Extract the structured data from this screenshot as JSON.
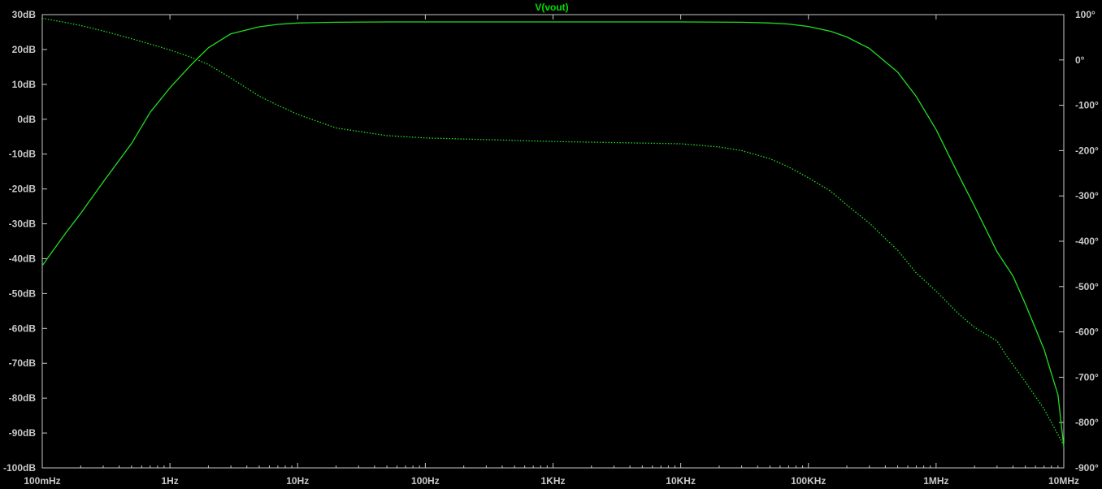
{
  "colors": {
    "background": "#000000",
    "axis": "#c8c8c8",
    "trace": "#22dd22"
  },
  "chart_data": {
    "type": "line",
    "title": "V(vout)",
    "xlabel": "",
    "ylabel": "",
    "x_scale": "log",
    "xlim": [
      0.1,
      10000000
    ],
    "ylim": [
      -100,
      30
    ],
    "y2lim": [
      -900,
      100
    ],
    "grid": false,
    "x_ticks": [
      {
        "value": 0.1,
        "label": "100mHz"
      },
      {
        "value": 1,
        "label": "1Hz"
      },
      {
        "value": 10,
        "label": "10Hz"
      },
      {
        "value": 100,
        "label": "100Hz"
      },
      {
        "value": 1000,
        "label": "1KHz"
      },
      {
        "value": 10000,
        "label": "10KHz"
      },
      {
        "value": 100000,
        "label": "100KHz"
      },
      {
        "value": 1000000,
        "label": "1MHz"
      },
      {
        "value": 10000000,
        "label": "10MHz"
      }
    ],
    "y_ticks": [
      {
        "value": 30,
        "label": "30dB"
      },
      {
        "value": 20,
        "label": "20dB"
      },
      {
        "value": 10,
        "label": "10dB"
      },
      {
        "value": 0,
        "label": "0dB"
      },
      {
        "value": -10,
        "label": "-10dB"
      },
      {
        "value": -20,
        "label": "-20dB"
      },
      {
        "value": -30,
        "label": "-30dB"
      },
      {
        "value": -40,
        "label": "-40dB"
      },
      {
        "value": -50,
        "label": "-50dB"
      },
      {
        "value": -60,
        "label": "-60dB"
      },
      {
        "value": -70,
        "label": "-70dB"
      },
      {
        "value": -80,
        "label": "-80dB"
      },
      {
        "value": -90,
        "label": "-90dB"
      },
      {
        "value": -100,
        "label": "-100dB"
      }
    ],
    "y2_ticks": [
      {
        "value": 100,
        "label": "100°"
      },
      {
        "value": 0,
        "label": "0°"
      },
      {
        "value": -100,
        "label": "-100°"
      },
      {
        "value": -200,
        "label": "-200°"
      },
      {
        "value": -300,
        "label": "-300°"
      },
      {
        "value": -400,
        "label": "-400°"
      },
      {
        "value": -500,
        "label": "-500°"
      },
      {
        "value": -600,
        "label": "-600°"
      },
      {
        "value": -700,
        "label": "-700°"
      },
      {
        "value": -800,
        "label": "-800°"
      },
      {
        "value": -900,
        "label": "-900°"
      }
    ],
    "series": [
      {
        "axis": "left",
        "style": "solid",
        "x": [
          0.1,
          0.15,
          0.2,
          0.3,
          0.5,
          0.7,
          1,
          1.5,
          2,
          3,
          5,
          7,
          10,
          20,
          50,
          100,
          1000,
          10000,
          30000,
          50000,
          70000,
          100000,
          150000,
          200000,
          300000,
          500000,
          700000,
          1000000,
          1500000,
          2000000,
          3000000,
          4000000,
          5000000,
          6000000,
          7000000,
          8000000,
          9000000,
          10000000
        ],
        "values": [
          -42,
          -33,
          -27,
          -18,
          -7,
          2,
          9,
          16,
          20.5,
          24.5,
          26.5,
          27.2,
          27.6,
          27.8,
          27.9,
          27.9,
          27.9,
          27.9,
          27.8,
          27.6,
          27.3,
          26.6,
          25.2,
          23.6,
          20.3,
          13.5,
          6.5,
          -3,
          -16,
          -25,
          -38,
          -45,
          -53,
          -60,
          -66,
          -73,
          -79,
          -94
        ]
      },
      {
        "axis": "right",
        "style": "dotted",
        "x": [
          0.1,
          0.15,
          0.2,
          0.3,
          0.5,
          0.7,
          1,
          1.5,
          2,
          3,
          5,
          7,
          10,
          20,
          50,
          100,
          1000,
          10000,
          20000,
          30000,
          50000,
          70000,
          100000,
          150000,
          200000,
          300000,
          500000,
          700000,
          1000000,
          1500000,
          2000000,
          3000000,
          3500000,
          5000000,
          7000000,
          10000000
        ],
        "values": [
          92,
          83,
          76,
          64,
          47,
          35,
          22,
          5,
          -10,
          -40,
          -80,
          -100,
          -120,
          -150,
          -167,
          -172,
          -180,
          -185,
          -192,
          -200,
          -218,
          -236,
          -260,
          -290,
          -320,
          -360,
          -420,
          -470,
          -510,
          -560,
          -590,
          -620,
          -650,
          -710,
          -770,
          -850
        ]
      }
    ]
  }
}
